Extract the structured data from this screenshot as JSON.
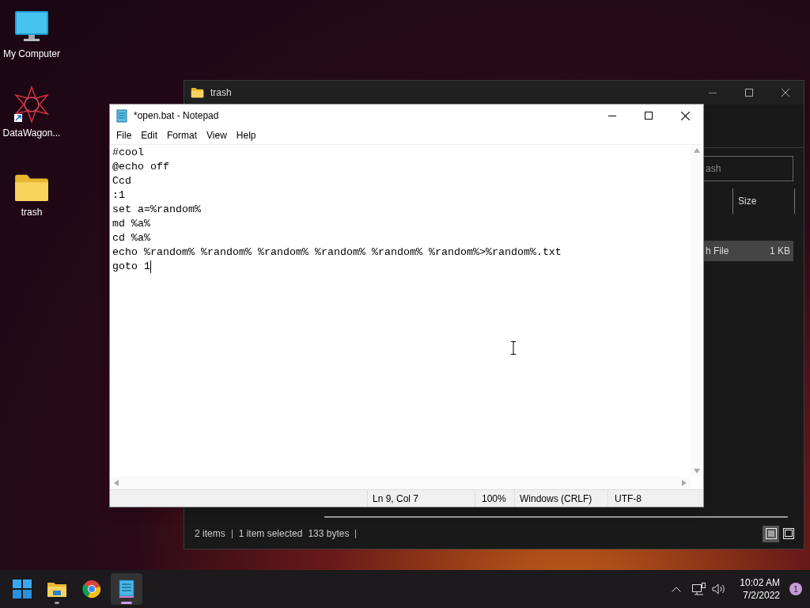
{
  "desktop_icons": [
    {
      "label": "My Computer",
      "kind": "monitor"
    },
    {
      "label": "DataWagon...",
      "kind": "shortcut"
    },
    {
      "label": "trash",
      "kind": "folder"
    }
  ],
  "explorer": {
    "title": "trash",
    "search": {
      "placeholder": "ash"
    },
    "columns": [
      "Size"
    ],
    "rows": [
      {
        "type": "h File",
        "size": "1 KB",
        "selected": true
      }
    ],
    "status": {
      "items": "2 items",
      "selection": "1 item selected",
      "size": "133 bytes"
    },
    "views": [
      {
        "kind": "details",
        "selected": true
      },
      {
        "kind": "tiles",
        "selected": false
      }
    ]
  },
  "notepad": {
    "title": "*open.bat - Notepad",
    "menu": [
      "File",
      "Edit",
      "Format",
      "View",
      "Help"
    ],
    "lines": [
      "#cool",
      "@echo off",
      "Ccd",
      ":1",
      "set a=%random%",
      "md %a%",
      "cd %a%",
      "echo %random% %random% %random% %random% %random% %random%>%random%.txt",
      "goto 1"
    ],
    "status": {
      "position": "Ln 9, Col 7",
      "zoom": "100%",
      "line_ending": "Windows (CRLF)",
      "encoding": "UTF-8"
    }
  },
  "taskbar": {
    "apps": [
      {
        "kind": "start",
        "running": false,
        "active": false
      },
      {
        "kind": "explorer",
        "running": true,
        "active": false
      },
      {
        "kind": "chrome",
        "running": false,
        "active": false
      },
      {
        "kind": "notepad",
        "running": true,
        "active": true
      }
    ],
    "time": "10:02 AM",
    "date": "7/2/2022",
    "notifications": "1"
  }
}
